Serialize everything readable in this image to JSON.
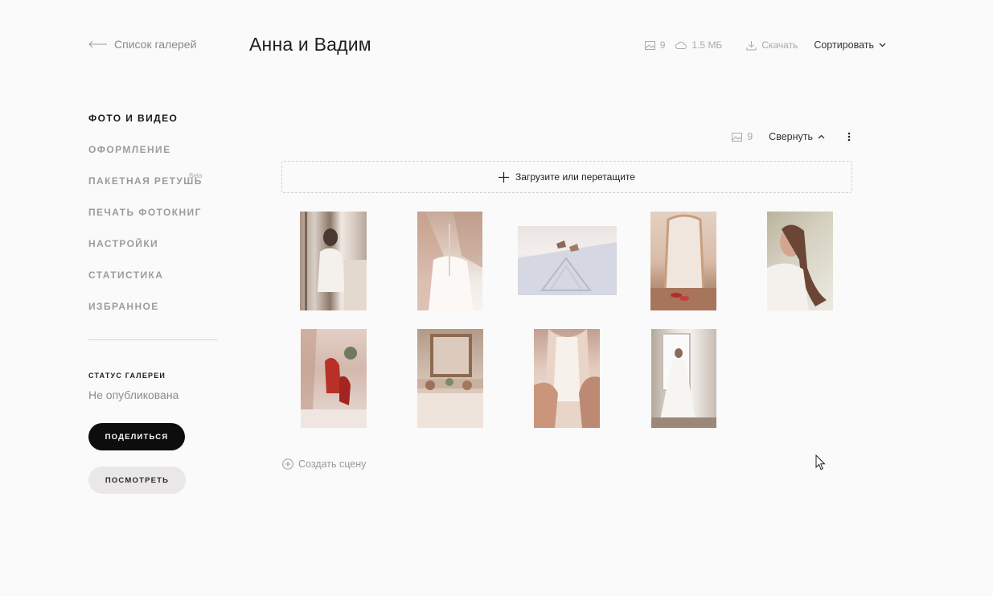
{
  "header": {
    "back_label": "Список галерей",
    "title": "Анна и Вадим",
    "photo_count": "9",
    "size": "1.5 МБ",
    "download_label": "Скачать",
    "sort_label": "Сортировать"
  },
  "sidebar": {
    "items": [
      {
        "label": "ФОТО И ВИДЕО",
        "active": true
      },
      {
        "label": "ОФОРМЛЕНИЕ"
      },
      {
        "label": "ПАКЕТНАЯ РЕТУШЬ",
        "badge": "Beta"
      },
      {
        "label": "ПЕЧАТЬ ФОТОКНИГ"
      },
      {
        "label": "НАСТРОЙКИ"
      },
      {
        "label": "СТАТИСТИКА"
      },
      {
        "label": "ИЗБРАННОЕ"
      }
    ],
    "status_label": "СТАТУС ГАЛЕРЕИ",
    "status_value": "Не опубликована",
    "share_label": "ПОДЕЛИТЬСЯ",
    "view_label": "ПОСМОТРЕТЬ"
  },
  "section": {
    "count": "9",
    "collapse_label": "Свернуть",
    "upload_label": "Загрузите или перетащите",
    "create_scene_label": "Создать сцену"
  },
  "photos": [
    {
      "description": "bride in front of mirror",
      "orientation": "portrait"
    },
    {
      "description": "buttoning the wedding dress",
      "orientation": "portrait"
    },
    {
      "description": "shoes on patterned floor",
      "orientation": "landscape"
    },
    {
      "description": "standing mirror with red shoes",
      "orientation": "portrait"
    },
    {
      "description": "smiling bride portrait",
      "orientation": "portrait"
    },
    {
      "description": "red shoes and flowers",
      "orientation": "portrait"
    },
    {
      "description": "mirror with flowers on table",
      "orientation": "portrait"
    },
    {
      "description": "lace back of the dress",
      "orientation": "portrait"
    },
    {
      "description": "bride by the window",
      "orientation": "portrait"
    }
  ],
  "colors": {
    "background": "#fafafa",
    "accent_beta": "#c79ac9",
    "share_button": "#0d0d0d",
    "view_button": "#e9e7e8"
  }
}
